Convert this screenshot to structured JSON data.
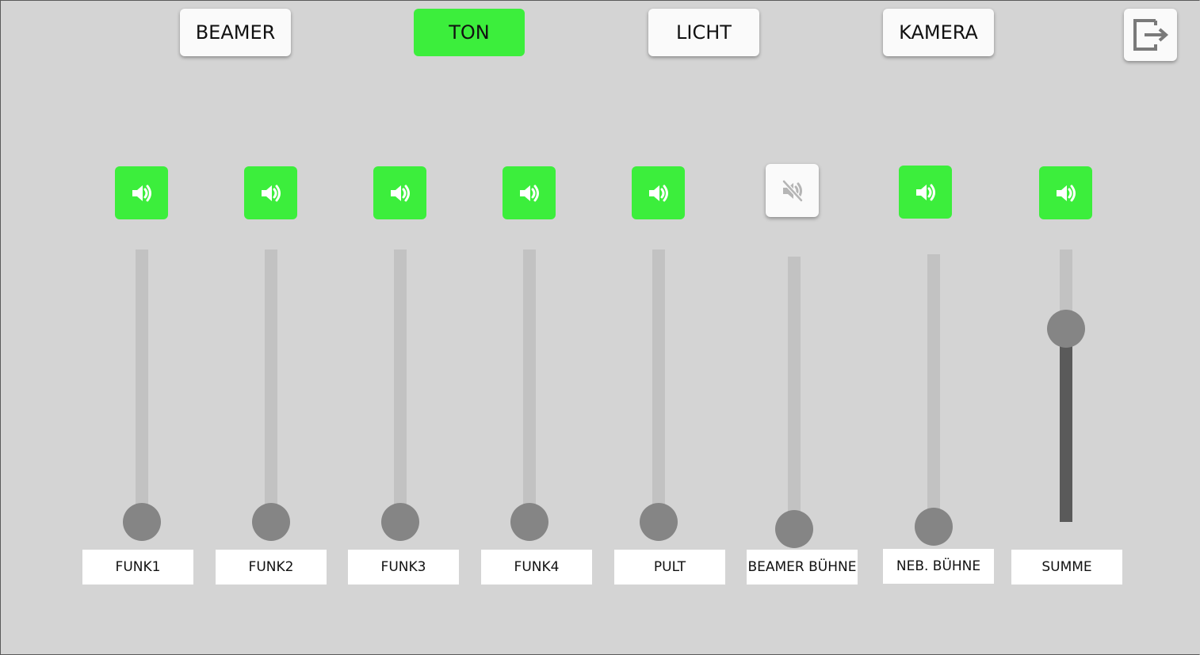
{
  "tabs": [
    {
      "label": "BEAMER",
      "active": false
    },
    {
      "label": "TON",
      "active": true
    },
    {
      "label": "LICHT",
      "active": false
    },
    {
      "label": "KAMERA",
      "active": false
    }
  ],
  "exit_icon": "exit-icon",
  "colors": {
    "active": "#3cee3c",
    "background": "#d4d4d4",
    "track": "#c2c2c2",
    "fill": "#5a5a5a",
    "thumb": "#858585"
  },
  "channels": [
    {
      "label": "FUNK1",
      "muted": false,
      "level": 0.0
    },
    {
      "label": "FUNK2",
      "muted": false,
      "level": 0.0
    },
    {
      "label": "FUNK3",
      "muted": false,
      "level": 0.0
    },
    {
      "label": "FUNK4",
      "muted": false,
      "level": 0.0
    },
    {
      "label": "PULT",
      "muted": false,
      "level": 0.0
    },
    {
      "label": "BEAMER BÜHNE",
      "muted": true,
      "level": 0.0
    },
    {
      "label": "NEB. BÜHNE",
      "muted": false,
      "level": 0.0
    },
    {
      "label": "SUMME",
      "muted": false,
      "level": 0.71
    }
  ]
}
